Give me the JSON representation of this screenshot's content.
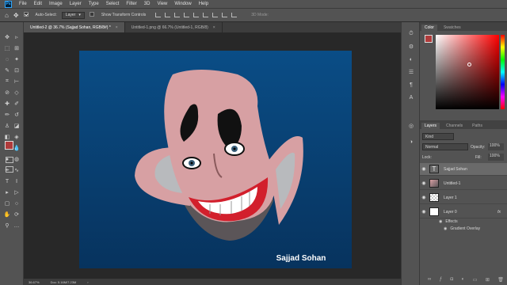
{
  "menu": {
    "items": [
      "File",
      "Edit",
      "Image",
      "Layer",
      "Type",
      "Select",
      "Filter",
      "3D",
      "View",
      "Window",
      "Help"
    ]
  },
  "options": {
    "auto_select_label": "Auto-Select:",
    "auto_select_value": "Layer",
    "transform_label": "Show Transform Controls",
    "mode_label": "3D Mode:"
  },
  "tabs": [
    {
      "label": "Untitled-2 @ 36.7% (Sajjad Sohan, RGB/8#) *"
    },
    {
      "label": "Untitled-1.png @ 66.7% (Untitled-1, RGB/8)"
    }
  ],
  "tab_close": "×",
  "canvas": {
    "signature": "Sajjad Sohan",
    "bg_top": "#0a4d86",
    "bg_bottom": "#07335e"
  },
  "status": {
    "zoom": "36.67%",
    "doc": "Doc: 5.16M/7.23M"
  },
  "color_panel": {
    "tabs": [
      "Color",
      "Swatches"
    ],
    "foreground": "#b03b3b"
  },
  "layers_panel": {
    "tabs": [
      "Layers",
      "Channels",
      "Paths"
    ],
    "kind_label": "Kind",
    "blend_mode": "Normal",
    "opacity_label": "Opacity:",
    "opacity_value": "100%",
    "lock_label": "Lock:",
    "fill_label": "Fill:",
    "fill_value": "100%",
    "layers": [
      {
        "name": "Sajjad Sohan",
        "type": "text"
      },
      {
        "name": "Untitled-1",
        "type": "image"
      },
      {
        "name": "Layer 1",
        "type": "transparent"
      },
      {
        "name": "Layer 0",
        "type": "fx"
      }
    ],
    "fx_badge": "fx",
    "effects_label": "Effects",
    "effect_name": "Gradient Overlay"
  }
}
